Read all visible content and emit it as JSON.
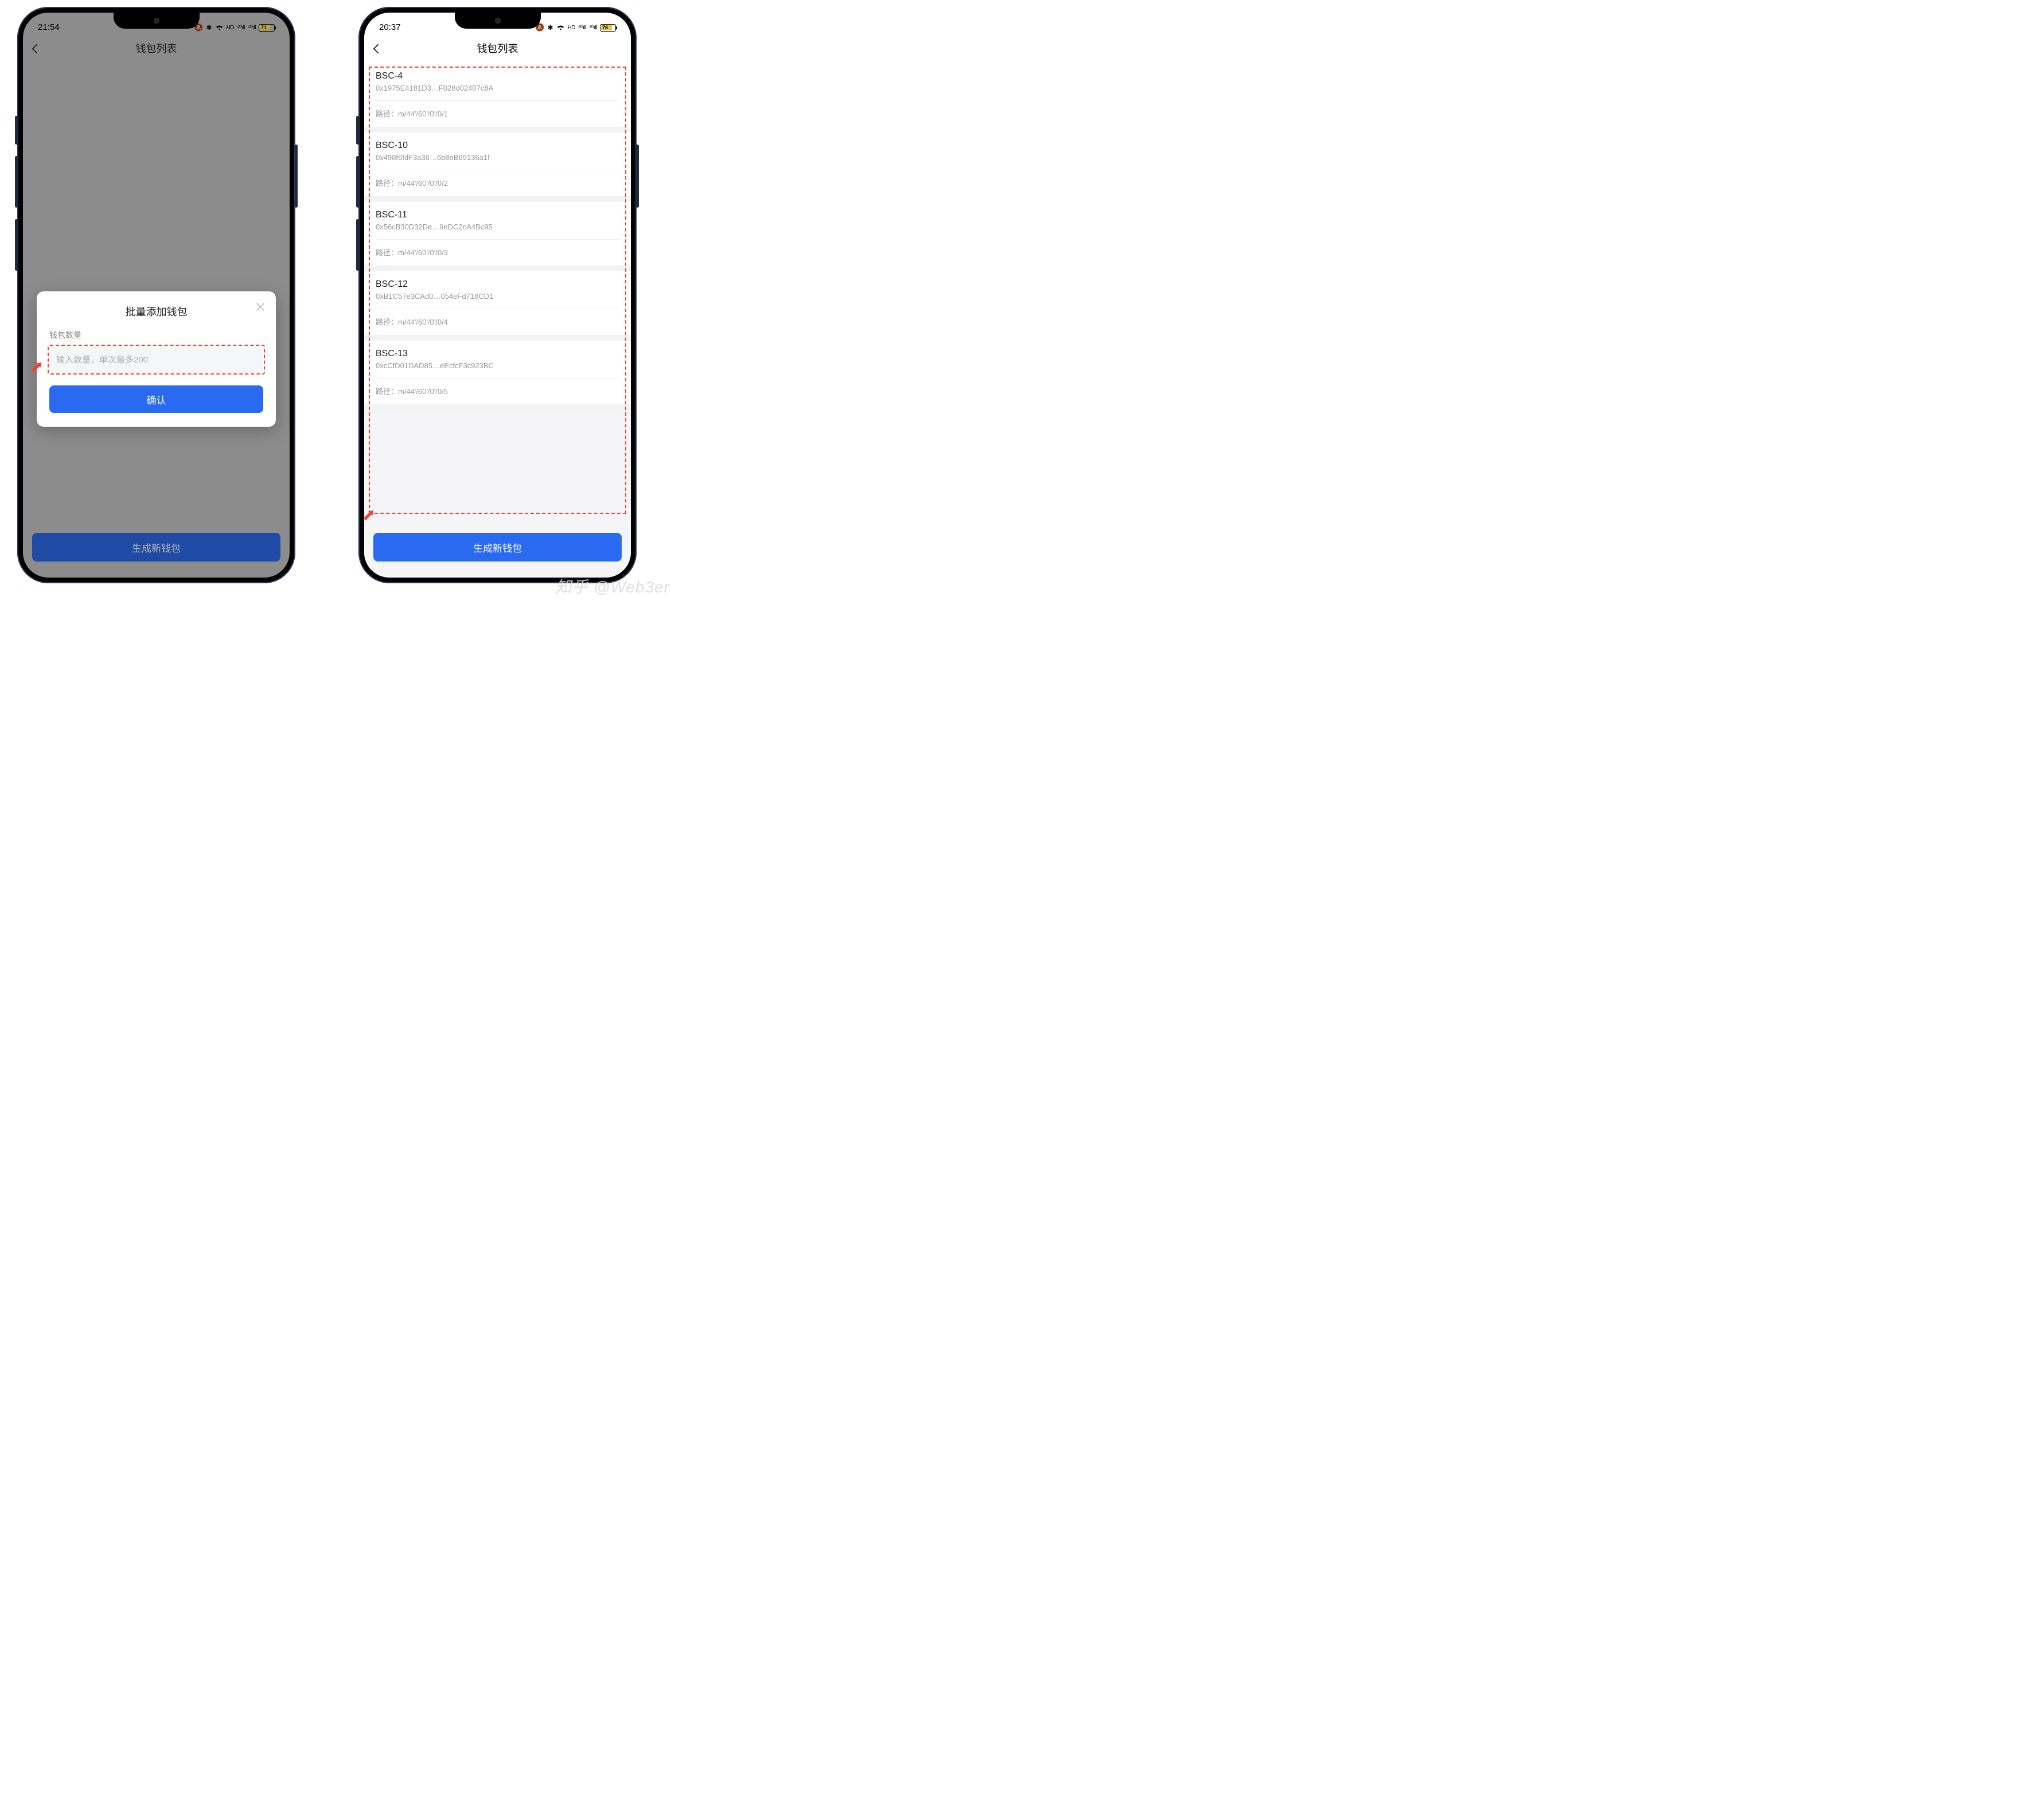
{
  "watermark": "知乎 @Web3er",
  "left": {
    "status": {
      "time": "21:54",
      "battery_pct": "71"
    },
    "nav": {
      "title": "钱包列表"
    },
    "bottom_button": "生成新钱包",
    "modal": {
      "title": "批量添加钱包",
      "label": "钱包数量",
      "placeholder": "输入数量，单次最多200",
      "confirm": "确认"
    }
  },
  "right": {
    "status": {
      "time": "20:37",
      "battery_pct": "78"
    },
    "nav": {
      "title": "钱包列表"
    },
    "bottom_button": "生成新钱包",
    "path_label": "路径：",
    "wallets": [
      {
        "name": "BSC-4",
        "address": "0x1975E4181D3…F028d02407c8A",
        "path": "m/44'/60'/0'/0/1"
      },
      {
        "name": "BSC-10",
        "address": "0x498f6fdF3a36…6b8eB69136a1f",
        "path": "m/44'/60'/0'/0/2"
      },
      {
        "name": "BSC-11",
        "address": "0x56cB30D32De…9eDC2cA4Bc95",
        "path": "m/44'/60'/0'/0/3"
      },
      {
        "name": "BSC-12",
        "address": "0xB1C57e3CAd0…054eFd718CD1",
        "path": "m/44'/60'/0'/0/4"
      },
      {
        "name": "BSC-13",
        "address": "0xcCfD01DAD85…eEcfcF3c923BC",
        "path": "m/44'/60'/0'/0/5"
      }
    ]
  }
}
